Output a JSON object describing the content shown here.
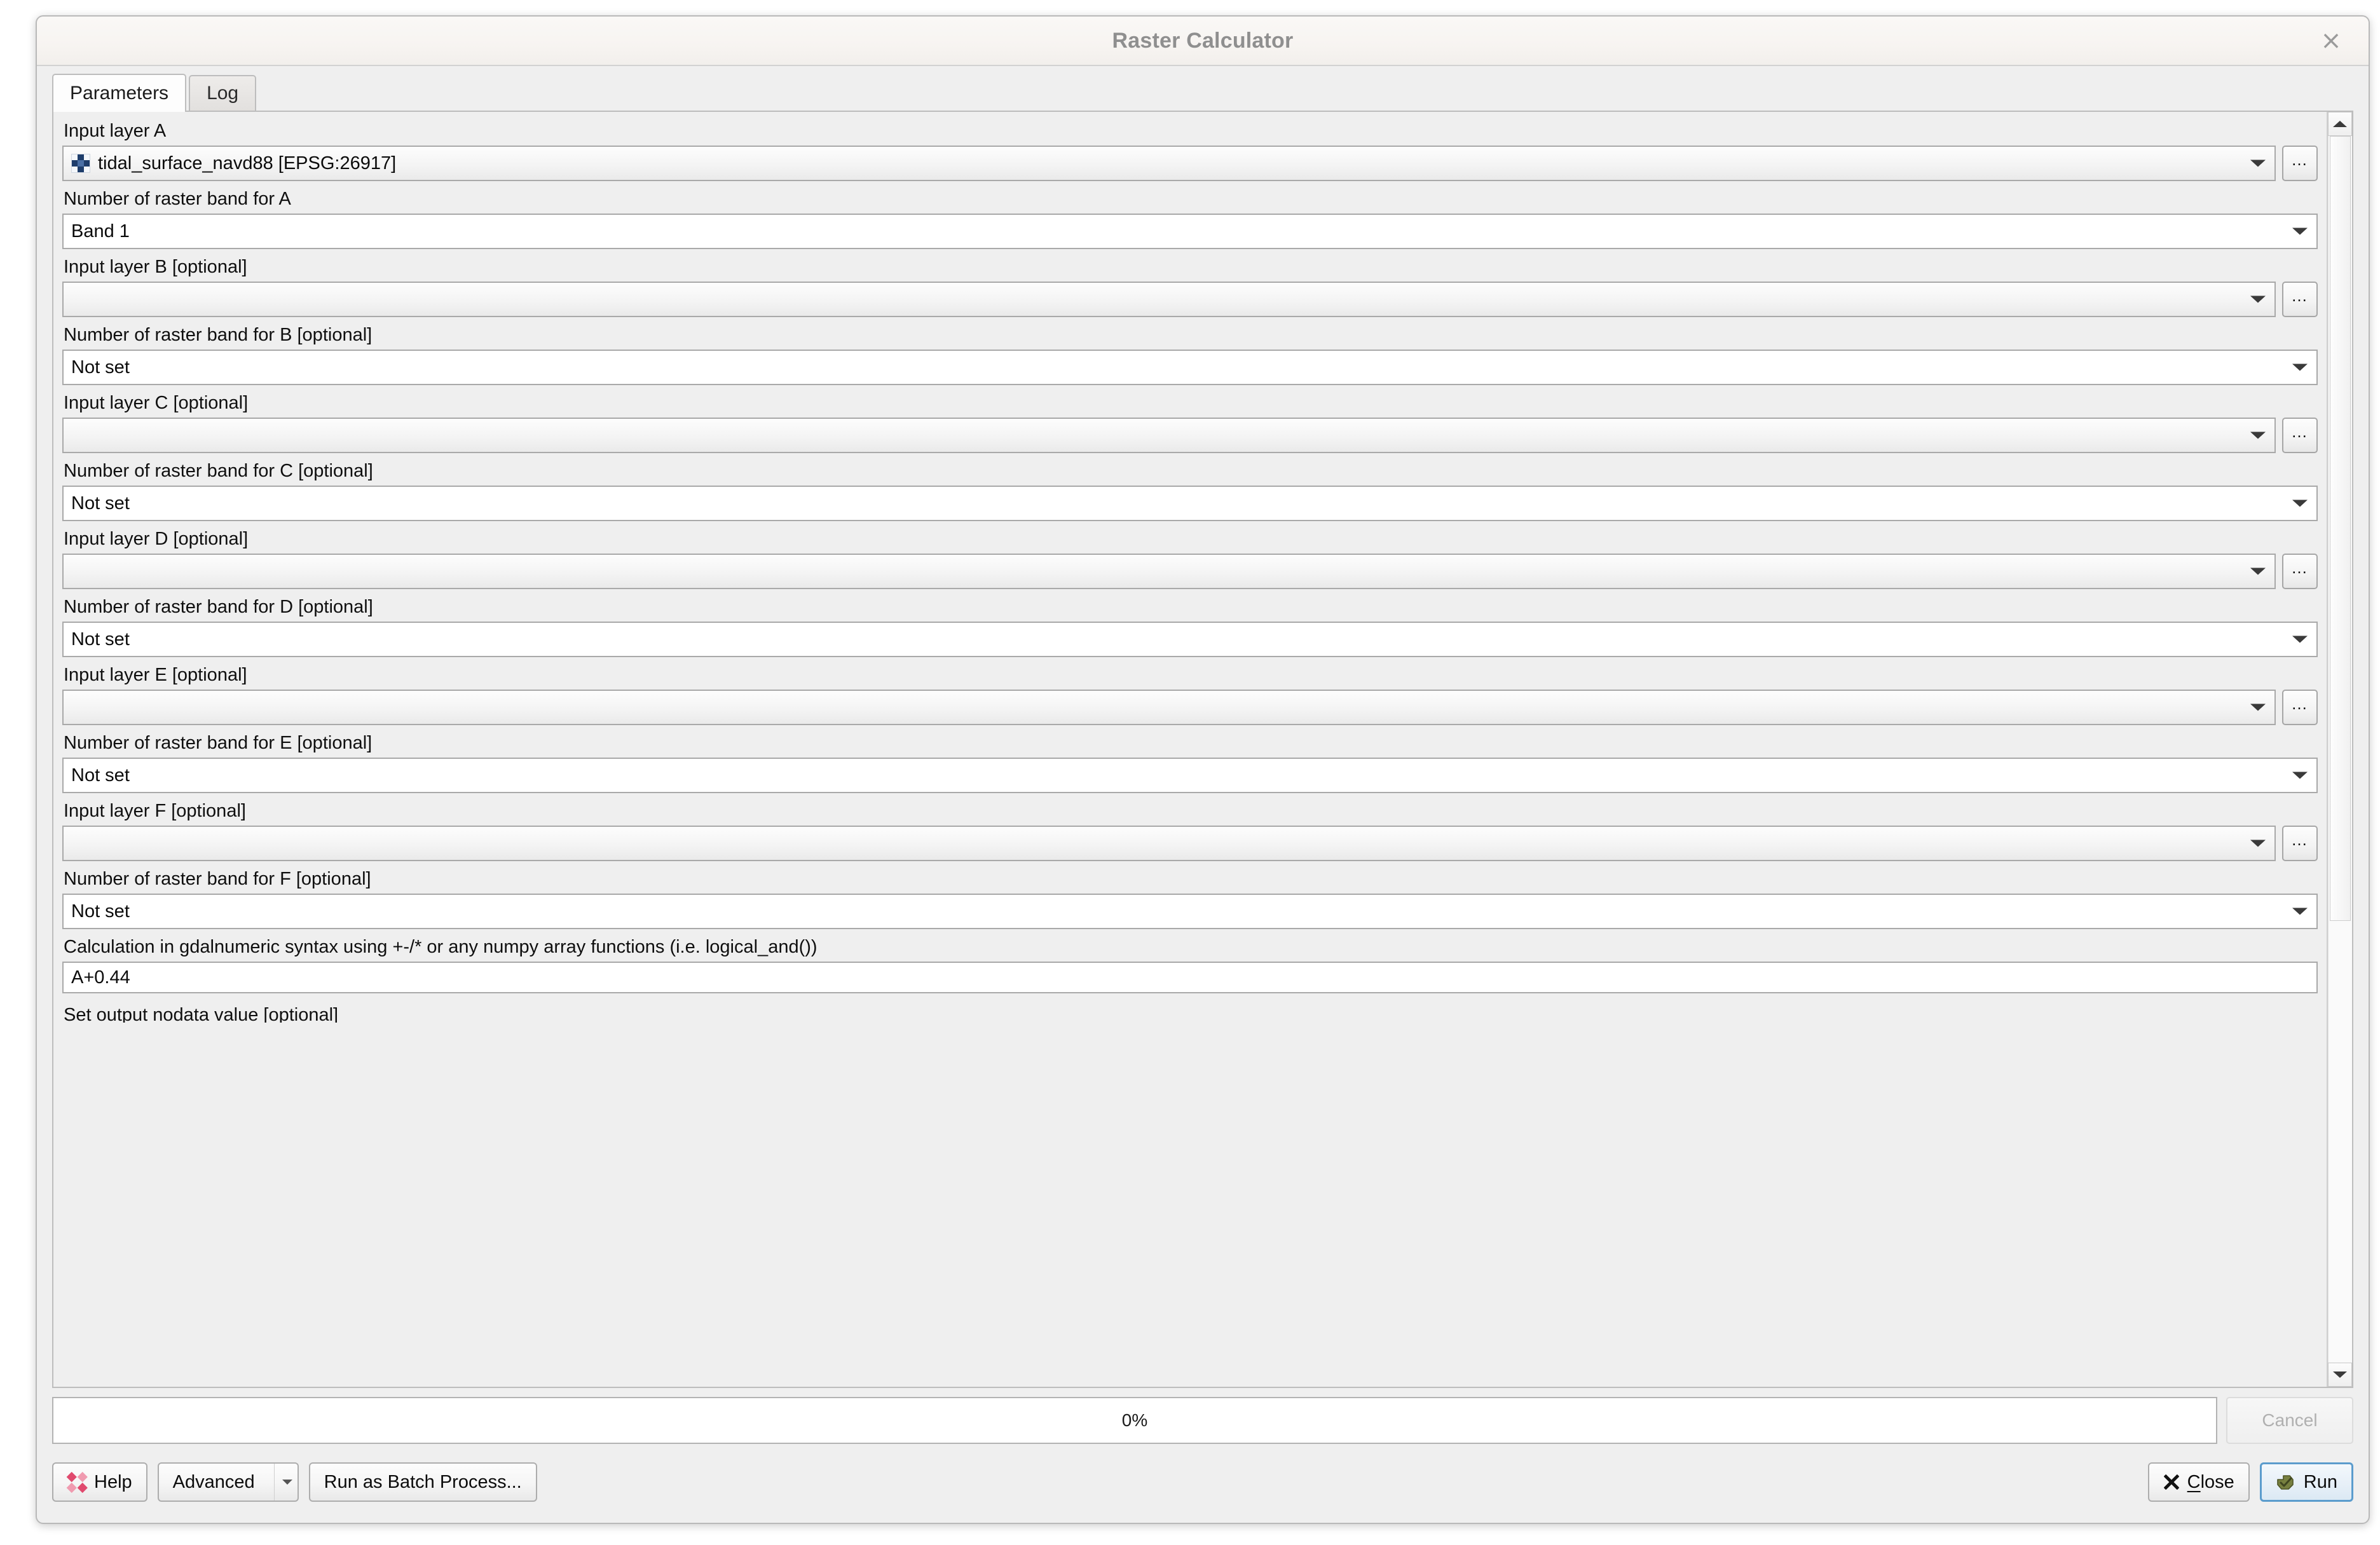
{
  "window": {
    "title": "Raster Calculator",
    "close_icon": "close-icon",
    "close_glyph": "×"
  },
  "tabs": [
    {
      "label": "Parameters",
      "active": true
    },
    {
      "label": "Log",
      "active": false
    }
  ],
  "form": {
    "rows": [
      {
        "label": "Input layer A",
        "kind": "layer",
        "value": "tidal_surface_navd88 [EPSG:26917]",
        "icon": "raster-layer-icon",
        "has_browse": true
      },
      {
        "label": "Number of raster band for A",
        "kind": "band",
        "value": "Band 1",
        "has_browse": false
      },
      {
        "label": "Input layer B [optional]",
        "kind": "layer",
        "value": "",
        "has_browse": true
      },
      {
        "label": "Number of raster band for B [optional]",
        "kind": "band",
        "value": "Not set",
        "has_browse": false
      },
      {
        "label": "Input layer C [optional]",
        "kind": "layer",
        "value": "",
        "has_browse": true
      },
      {
        "label": "Number of raster band for C [optional]",
        "kind": "band",
        "value": "Not set",
        "has_browse": false
      },
      {
        "label": "Input layer D [optional]",
        "kind": "layer",
        "value": "",
        "has_browse": true
      },
      {
        "label": "Number of raster band for D [optional]",
        "kind": "band",
        "value": "Not set",
        "has_browse": false
      },
      {
        "label": "Input layer E [optional]",
        "kind": "layer",
        "value": "",
        "has_browse": true
      },
      {
        "label": "Number of raster band for E [optional]",
        "kind": "band",
        "value": "Not set",
        "has_browse": false
      },
      {
        "label": "Input layer F [optional]",
        "kind": "layer",
        "value": "",
        "has_browse": true
      },
      {
        "label": "Number of raster band for F [optional]",
        "kind": "band",
        "value": "Not set",
        "has_browse": false
      }
    ],
    "calculation": {
      "label": "Calculation in gdalnumeric syntax using +-/* or any numpy array functions (i.e. logical_and())",
      "value": "A+0.44"
    },
    "clipped_label": "Set output nodata value [optional]"
  },
  "scrollbar": {
    "up_icon": "scroll-up-arrow-icon",
    "down_icon": "scroll-down-arrow-icon",
    "thumb_position_percent": 0,
    "thumb_size_percent": 64
  },
  "progress": {
    "percent_text": "0%",
    "value": 0,
    "cancel_label": "Cancel",
    "cancel_enabled": false
  },
  "buttons": {
    "help": "Help",
    "advanced": "Advanced",
    "run_batch": "Run as Batch Process...",
    "close": "Close",
    "run": "Run"
  },
  "colors": {
    "dialog_bg": "#efefef",
    "titlebar_bg": "#f7f4f1",
    "title_fg": "#8f8f8f",
    "field_border": "#a9a9a9",
    "default_button_ring": "#5b9ccd",
    "help_icon": "#e04a6e",
    "run_icon": "#6b7a3a"
  }
}
